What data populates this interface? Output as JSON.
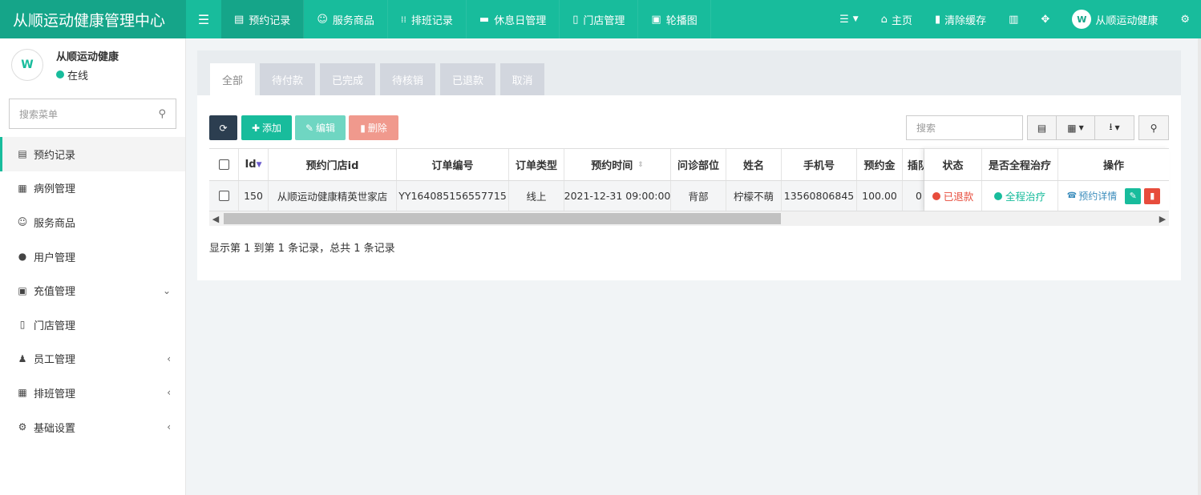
{
  "app": {
    "title": "从顺运动健康管理中心",
    "logo_short": "W"
  },
  "topnav": {
    "tabs": [
      {
        "label": "预约记录",
        "icon": "list-alt-icon",
        "glyph": "▤"
      },
      {
        "label": "服务商品",
        "icon": "smile-icon",
        "glyph": "☺"
      },
      {
        "label": "排班记录",
        "icon": "barcode-icon",
        "glyph": "⁞⁞"
      },
      {
        "label": "休息日管理",
        "icon": "bed-icon",
        "glyph": "▬"
      },
      {
        "label": "门店管理",
        "icon": "building-icon",
        "glyph": "▯"
      },
      {
        "label": "轮播图",
        "icon": "image-icon",
        "glyph": "▣"
      }
    ],
    "home": "主页",
    "clear_cache": "清除缓存",
    "user": "从顺运动健康"
  },
  "sidebar": {
    "user_name": "从顺运动健康",
    "user_status": "在线",
    "search_placeholder": "搜索菜单",
    "items": [
      {
        "label": "预约记录",
        "icon": "list-alt-icon",
        "glyph": "▤",
        "arrow": ""
      },
      {
        "label": "病例管理",
        "icon": "calendar-plus-icon",
        "glyph": "▦",
        "arrow": ""
      },
      {
        "label": "服务商品",
        "icon": "smile-icon",
        "glyph": "☺",
        "arrow": ""
      },
      {
        "label": "用户管理",
        "icon": "user-icon",
        "glyph": "●",
        "arrow": ""
      },
      {
        "label": "充值管理",
        "icon": "money-icon",
        "glyph": "▣",
        "arrow": "⌄"
      },
      {
        "label": "门店管理",
        "icon": "building-icon",
        "glyph": "▯",
        "arrow": ""
      },
      {
        "label": "员工管理",
        "icon": "user-secret-icon",
        "glyph": "♟",
        "arrow": "‹"
      },
      {
        "label": "排班管理",
        "icon": "calendar-icon",
        "glyph": "▦",
        "arrow": "‹"
      },
      {
        "label": "基础设置",
        "icon": "cogs-icon",
        "glyph": "⚙",
        "arrow": "‹"
      }
    ]
  },
  "tabs": [
    "全部",
    "待付款",
    "已完成",
    "待核销",
    "已退款",
    "取消"
  ],
  "toolbar": {
    "add": "添加",
    "edit": "编辑",
    "delete": "删除",
    "search_placeholder": "搜索"
  },
  "table": {
    "headers": [
      "Id",
      "预约门店id",
      "订单编号",
      "订单类型",
      "预约时间",
      "问诊部位",
      "姓名",
      "手机号",
      "预约金",
      "插队"
    ],
    "row": [
      "150",
      "从顺运动健康精英世家店",
      "YY164085156557715",
      "线上",
      "2021-12-31 09:00:00",
      "背部",
      "柠檬不萌",
      "13560806845",
      "100.00",
      "0"
    ],
    "fixed_headers": [
      "状态",
      "是否全程治疗",
      "操作"
    ],
    "status": "已退款",
    "treatment": "全程治疗",
    "detail": "预约详情"
  },
  "pagination": {
    "info": "显示第 1 到第 1 条记录，总共 1 条记录"
  },
  "colors": {
    "primary": "#18bc9c",
    "primary_dark": "#15a589",
    "dark_button": "#2c3e50",
    "edit_button": "#6fd6c2",
    "delete_button": "#f0998d",
    "danger": "#e74c3c"
  }
}
